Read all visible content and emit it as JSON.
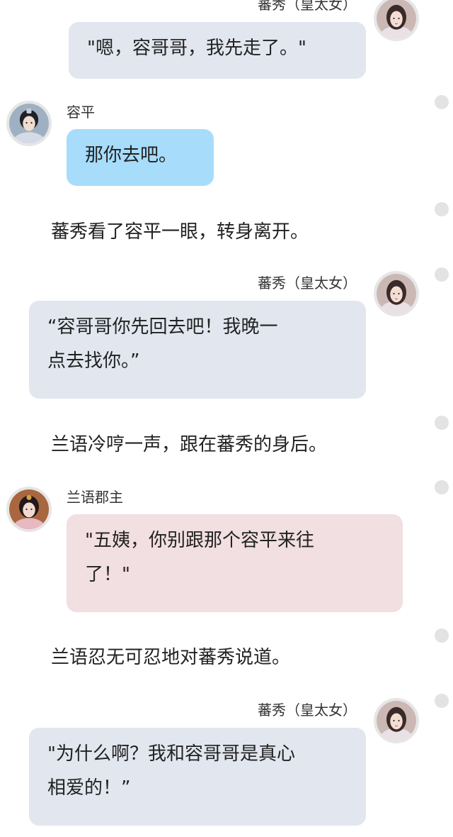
{
  "messages": {
    "m1": {
      "speaker": "蕃秀（皇太女）",
      "text": "\"嗯，容哥哥，我先走了。\""
    },
    "m2": {
      "speaker": "容平",
      "text": "那你去吧。"
    },
    "n1": {
      "text": "蕃秀看了容平一眼，转身离开。"
    },
    "m3": {
      "speaker": "蕃秀（皇太女）",
      "line1": "“容哥哥你先回去吧！我晚一",
      "line2": "点去找你。”"
    },
    "n2": {
      "text": "兰语冷哼一声，跟在蕃秀的身后。"
    },
    "m4": {
      "speaker": "兰语郡主",
      "line1": "\"五姨，你别跟那个容平来往",
      "line2": "了！\""
    },
    "n3": {
      "text": "兰语忍无可忍地对蕃秀说道。"
    },
    "m5": {
      "speaker": "蕃秀（皇太女）",
      "line1": "\"为什么啊？我和容哥哥是真心",
      "line2": "相爱的！”"
    }
  },
  "colors": {
    "bubble_grey": "#e1e6ef",
    "bubble_blue": "#a7dcfb",
    "bubble_pink": "#f2dfe1",
    "scroll_dot": "#e3e3e3"
  },
  "icons": {
    "avatar_fanxiu": "avatar-fanxiu-icon",
    "avatar_rongping": "avatar-rongping-icon",
    "avatar_lanyu": "avatar-lanyu-icon"
  }
}
